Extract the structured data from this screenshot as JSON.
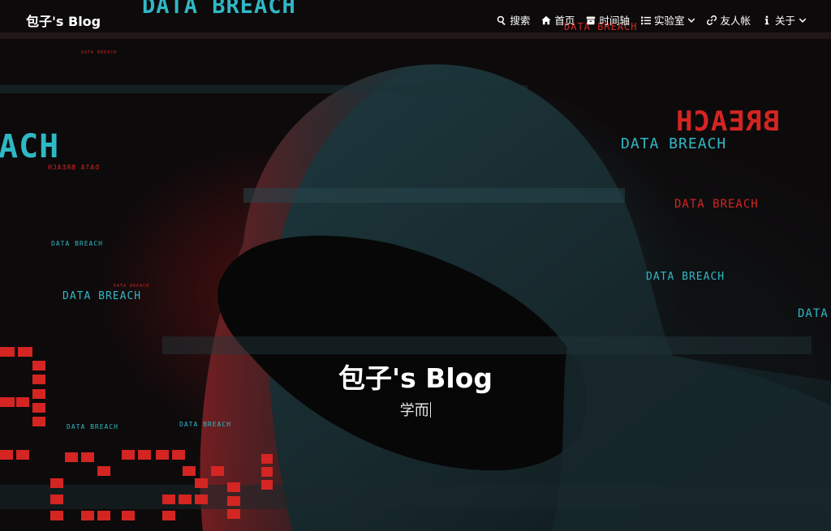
{
  "brand": "包子's Blog",
  "nav": {
    "items": [
      {
        "label": "搜索",
        "icon": "search-icon"
      },
      {
        "label": "首页",
        "icon": "home-icon"
      },
      {
        "label": "时间轴",
        "icon": "archive-icon"
      },
      {
        "label": "实验室",
        "icon": "list-icon",
        "dropdown": true
      },
      {
        "label": "友人帐",
        "icon": "link-icon"
      },
      {
        "label": "关于",
        "icon": "info-icon",
        "dropdown": true
      }
    ]
  },
  "hero": {
    "title": "包子's Blog",
    "subtitle": "学而"
  },
  "background": {
    "texts": [
      "DATA BREACH",
      "DATA BREACH",
      "DATA BREACH",
      "DATA BREACH",
      "DATA BREACH",
      "DATA BREACH",
      "DATA BREACH",
      "DATA BREACH",
      "DATA BREACH",
      "DATA BREACH",
      "DATA BREACH",
      "DATA BREACH",
      "DATA BREACH",
      "ACH",
      "BREACH"
    ],
    "colors": {
      "cyan": "#2fb8c4",
      "red": "#d42522"
    }
  }
}
